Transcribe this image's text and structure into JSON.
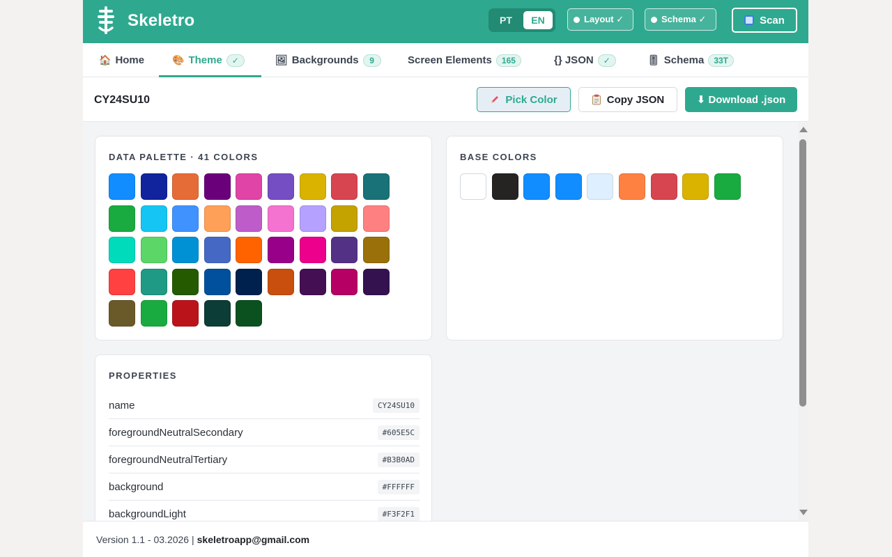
{
  "app": {
    "brand": "Skeletro",
    "languages": [
      {
        "label": "PT",
        "active": false
      },
      {
        "label": "EN",
        "active": true
      }
    ],
    "chips": {
      "layout": "Layout ✓",
      "schema": "Schema ✓"
    },
    "scan_label": "Scan",
    "accent_color": "#2ea98f"
  },
  "tabs": [
    {
      "icon": "🏠",
      "label": "Home",
      "badge": ""
    },
    {
      "icon": "🎨",
      "label": "Theme",
      "badge": "✓",
      "active": true
    },
    {
      "icon": "🖼",
      "label": "Backgrounds",
      "badge": "9"
    },
    {
      "icon": "",
      "label": "Screen Elements",
      "badge": "165"
    },
    {
      "icon": "",
      "label": "{} JSON",
      "badge": "✓"
    },
    {
      "icon": "🎚",
      "label": "Schema",
      "badge": "33T"
    }
  ],
  "toolbar": {
    "theme_name": "CY24SU10",
    "pick_color": "Pick Color",
    "copy_json": "Copy JSON",
    "download": "⬇ Download .json"
  },
  "data_palette": {
    "title": "DATA PALETTE · 41 COLORS",
    "colors": [
      "#118DFF",
      "#12239E",
      "#E66C37",
      "#6B007B",
      "#E044A7",
      "#744EC2",
      "#D9B300",
      "#D64550",
      "#197278",
      "#1AAB40",
      "#15C6F4",
      "#4092FF",
      "#FFA058",
      "#BE5DC9",
      "#F472D0",
      "#B5A1FF",
      "#C4A200",
      "#FF8080",
      "#00DBBC",
      "#5BD667",
      "#0091D5",
      "#4668C5",
      "#FF6300",
      "#99008A",
      "#EC008C",
      "#533285",
      "#99700A",
      "#FF4141",
      "#1F9A85",
      "#255A00",
      "#00509D",
      "#00204E",
      "#C94F0F",
      "#450F54",
      "#B60064",
      "#34124F",
      "#6A5A29",
      "#1AAB40",
      "#BA141A",
      "#0C3D37",
      "#0B511F"
    ]
  },
  "base_colors": {
    "title": "BASE COLORS",
    "colors": [
      "#FFFFFF",
      "#252423",
      "#118DFF",
      "#118DFF",
      "#DEEFFF",
      "#FF8142",
      "#D64550",
      "#D9B300",
      "#1AAB40"
    ]
  },
  "properties": {
    "title": "PROPERTIES",
    "rows": [
      {
        "key": "name",
        "value": "CY24SU10"
      },
      {
        "key": "foregroundNeutralSecondary",
        "value": "#605E5C"
      },
      {
        "key": "foregroundNeutralTertiary",
        "value": "#B3B0AD"
      },
      {
        "key": "background",
        "value": "#FFFFFF"
      },
      {
        "key": "backgroundLight",
        "value": "#F3F2F1"
      }
    ]
  },
  "footer": {
    "version": "Version 1.1 - 03.2026 |",
    "email": "skeletroapp@gmail.com"
  }
}
